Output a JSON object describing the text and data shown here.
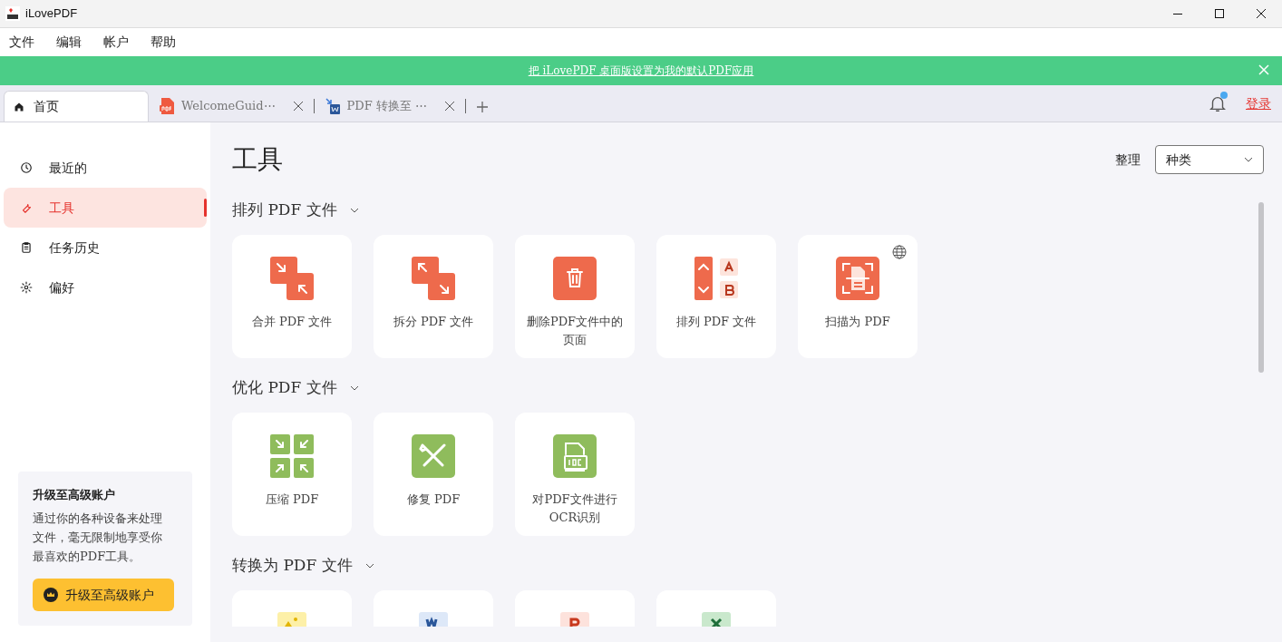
{
  "window": {
    "title": "iLovePDF"
  },
  "menu": [
    "文件",
    "编辑",
    "帐户",
    "帮助"
  ],
  "banner": {
    "text": "把 iLovePDF 桌面版设置为我的默认PDF应用"
  },
  "tabs": [
    {
      "label": "首页",
      "kind": "home",
      "selected": true,
      "closable": false
    },
    {
      "label": "WelcomeGuid⋯",
      "kind": "pdf",
      "selected": false,
      "closable": true
    },
    {
      "label": "PDF 转换至 ⋯",
      "kind": "word",
      "selected": false,
      "closable": true
    }
  ],
  "header": {
    "notification": true,
    "login": "登录"
  },
  "sidebar": {
    "items": [
      {
        "label": "最近的",
        "kind": "clock",
        "selected": false
      },
      {
        "label": "工具",
        "kind": "wrench",
        "selected": true
      },
      {
        "label": "任务历史",
        "kind": "clipboard",
        "selected": false
      },
      {
        "label": "偏好",
        "kind": "gear",
        "selected": false
      }
    ],
    "promo": {
      "title": "升级至高级账户",
      "text": "通过你的各种设备来处理文件，毫无限制地享受你最喜欢的PDF工具。",
      "button": "升级至高级账户"
    }
  },
  "main": {
    "title": "工具",
    "sort": {
      "label": "整理",
      "value": "种类"
    },
    "sections": [
      {
        "title": "排列 PDF 文件",
        "expanded": true,
        "tools": [
          {
            "label": "合并 PDF 文件",
            "kind": "merge",
            "online": false
          },
          {
            "label": "拆分 PDF 文件",
            "kind": "split",
            "online": false
          },
          {
            "label": "删除PDF文件中的页面",
            "kind": "delete",
            "online": false
          },
          {
            "label": "排列 PDF 文件",
            "kind": "organize",
            "online": false
          },
          {
            "label": "扫描为 PDF",
            "kind": "scan",
            "online": true
          }
        ]
      },
      {
        "title": "优化 PDF 文件",
        "expanded": true,
        "tools": [
          {
            "label": "压缩 PDF",
            "kind": "compress",
            "online": false
          },
          {
            "label": "修复 PDF",
            "kind": "repair",
            "online": false
          },
          {
            "label": "对PDF文件进行OCR识别",
            "kind": "ocr",
            "online": false
          }
        ]
      },
      {
        "title": "转换为 PDF 文件",
        "expanded": true,
        "tools": [
          {
            "kind": "image",
            "online": false
          },
          {
            "kind": "word",
            "online": false
          },
          {
            "kind": "powerpoint",
            "online": false
          },
          {
            "kind": "excel",
            "online": false
          }
        ]
      }
    ]
  }
}
